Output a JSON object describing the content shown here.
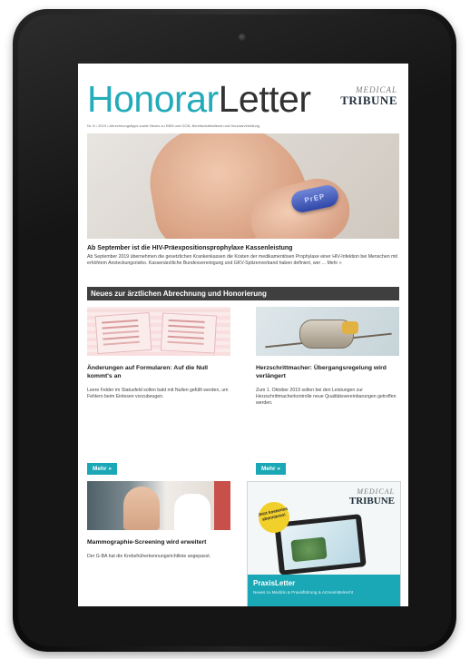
{
  "masthead": {
    "brand_part1": "Honorar",
    "brand_part2": "Letter",
    "publisher_line1": "MEDICAL",
    "publisher_line2": "TRIBUNE",
    "subline": "Nr. 8 • 2019 • Abrechnungstipps sowie Neues zu EBM und GOÄ, Bereitschaftsdienst und Honorarverteilung"
  },
  "hero": {
    "pill_text": "PrEP"
  },
  "lead": {
    "title": "Ab September ist die HIV-Präexpositionsprophylaxe Kassenleistung",
    "text": "Ab September 2019 übernehmen die gesetzlichen Krankenkassen die Kosten der medikamentösen Prophylaxe einer HIV-Infektion bei Menschen mit erhöhtem Ansteckungsrisiko. Kassenärztliche Bundesvereinigung und GKV-Spitzenverband haben definiert, wer ...",
    "more_link": "Mehr »"
  },
  "section": {
    "title": "Neues zur ärztlichen Abrechnung und Honorierung"
  },
  "articles": [
    {
      "title": "Änderungen auf Formularen: Auf die Null kommt's an",
      "text": "Leere Felder im Statusfeld sollen bald mit Nullen gefüllt werden, um Fehlern beim Einlesen vorzubeugen.",
      "button": "Mehr »"
    },
    {
      "title": "Herzschrittmacher: Übergangsregelung wird verlängert",
      "text": "Zum 1. Oktober 2019 sollen bei den Leistungen zur Herzschrittmacherkontrolle neue Qualitätsvereinbarungen getroffen werden.",
      "button": "Mehr »"
    },
    {
      "title": "Mammographie-Screening wird erweitert",
      "text": "Der G-BA hat die Krebsfrüherkennungsrichtlinie angepasst."
    }
  ],
  "promo": {
    "logo_line1": "MEDICAL",
    "logo_line2": "TRIBUNE",
    "badge": "Jetzt kostenlos abonnieren!",
    "title": "PraxisLetter",
    "text": "Neues zu Medizin & Praxisführung & Arzneimittelrecht"
  },
  "colors": {
    "accent": "#1aa7b6",
    "section_bar": "#3f3f3f",
    "device_frame": "#151515"
  }
}
